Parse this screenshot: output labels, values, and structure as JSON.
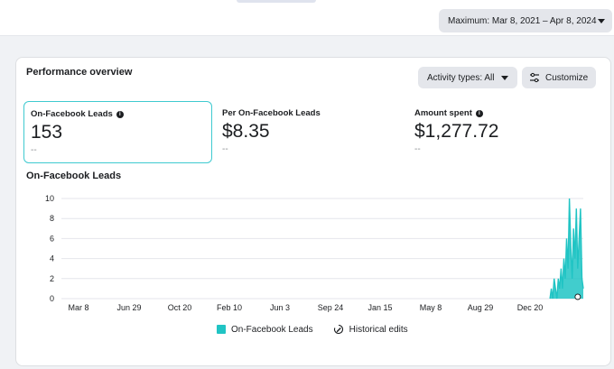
{
  "header": {
    "date_range_label": "Maximum: Mar 8, 2021 – Apr 8, 2024"
  },
  "overview": {
    "title": "Performance overview",
    "activity_label": "Activity types: All",
    "customize_label": "Customize",
    "metrics": [
      {
        "label": "On-Facebook Leads",
        "value": "153",
        "sub": "--",
        "has_info": true
      },
      {
        "label": "Per On-Facebook Leads",
        "value": "$8.35",
        "sub": "--",
        "has_info": false
      },
      {
        "label": "Amount spent",
        "value": "$1,277.72",
        "sub": "--",
        "has_info": true
      }
    ],
    "chart_title": "On-Facebook Leads",
    "legend": {
      "series_label": "On-Facebook Leads",
      "edits_label": "Historical edits"
    }
  },
  "colors": {
    "series": "#20c4c4",
    "selected_border": "#3fcad0",
    "grid": "#e4e6eb"
  },
  "icons": {
    "caret": "caret-down-icon",
    "customize": "sliders-icon",
    "info": "info-icon",
    "edits": "historical-edits-icon"
  },
  "chart_data": {
    "type": "area",
    "ylim": [
      0,
      10
    ],
    "yticks": [
      0,
      2,
      4,
      6,
      8,
      10
    ],
    "xticks": [
      "Mar 8",
      "Jun 29",
      "Oct 20",
      "Feb 10",
      "Jun 3",
      "Sep 24",
      "Jan 15",
      "May 8",
      "Aug 29",
      "Dec 20"
    ],
    "series": [
      {
        "name": "On-Facebook Leads",
        "x": [
          "Jan 27, 2024",
          "Jan 30, 2024",
          "Feb 2, 2024",
          "Feb 5, 2024",
          "Feb 8, 2024",
          "Feb 11, 2024",
          "Feb 14, 2024",
          "Feb 17, 2024",
          "Feb 20, 2024",
          "Feb 23, 2024",
          "Feb 26, 2024",
          "Feb 29, 2024",
          "Mar 3, 2024",
          "Mar 6, 2024",
          "Mar 9, 2024",
          "Mar 12, 2024",
          "Mar 15, 2024",
          "Mar 18, 2024",
          "Mar 21, 2024",
          "Mar 24, 2024",
          "Mar 27, 2024",
          "Mar 30, 2024",
          "Apr 2, 2024",
          "Apr 5, 2024",
          "Apr 8, 2024"
        ],
        "values": [
          0,
          1,
          0,
          2,
          1,
          0,
          2,
          1,
          3,
          1,
          4,
          2,
          6,
          3,
          10,
          5,
          2,
          7,
          4,
          9,
          3,
          6,
          9,
          2,
          1
        ]
      }
    ]
  }
}
